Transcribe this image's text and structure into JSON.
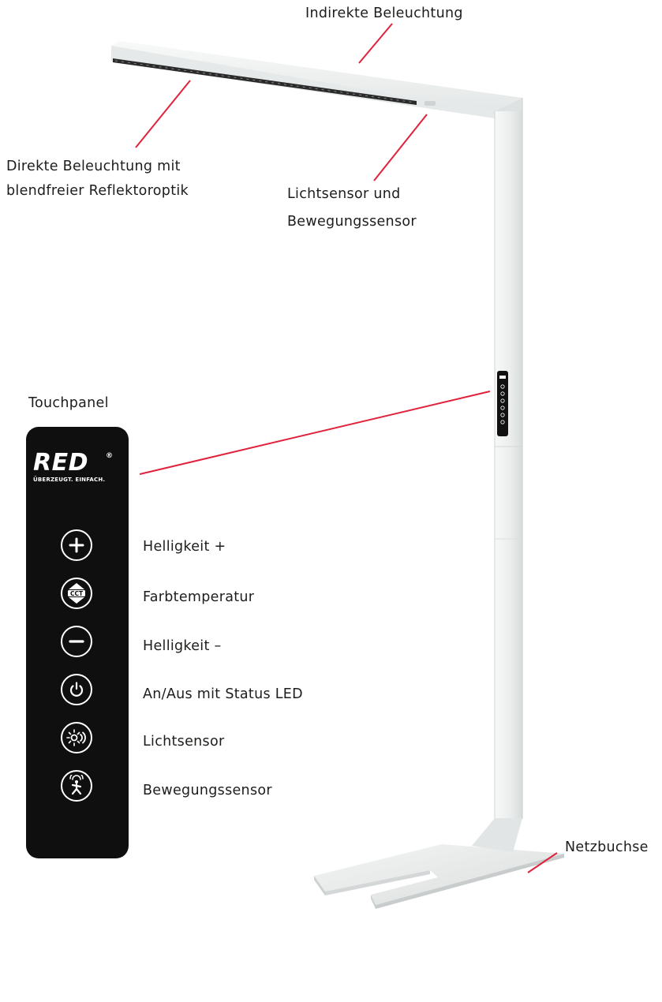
{
  "callouts": {
    "indirect": "Indirekte Beleuchtung",
    "direct_line1": "Direkte Beleuchtung mit",
    "direct_line2": "blendfreier Reflektoroptik",
    "sensor_line1": "Lichtsensor und",
    "sensor_line2": "Bewegungssensor",
    "touchpanel": "Touchpanel",
    "socket": "Netzbuchse"
  },
  "panel": {
    "brand": "RED",
    "registered": "®",
    "tagline": "ÜBERZEUGT. EINFACH.",
    "cct_text": "CCT",
    "buttons": [
      {
        "label": "Helligkeit +",
        "icon": "plus-icon"
      },
      {
        "label": "Farbtemperatur",
        "icon": "cct-icon"
      },
      {
        "label": "Helligkeit –",
        "icon": "minus-icon"
      },
      {
        "label": "An/Aus mit Status LED",
        "icon": "power-icon"
      },
      {
        "label": "Lichtsensor",
        "icon": "light-sensor-icon"
      },
      {
        "label": "Bewegungssensor",
        "icon": "motion-sensor-icon"
      }
    ]
  },
  "colors": {
    "leader_line": "#e0223c",
    "panel_bg": "#0f0f0f",
    "lamp_body": "#eef0f0"
  }
}
